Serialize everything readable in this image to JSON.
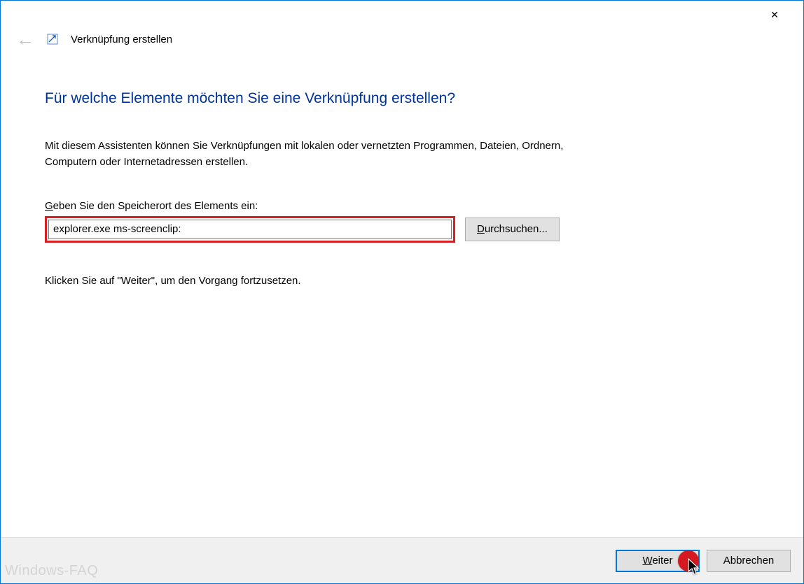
{
  "wizard": {
    "title": "Verknüpfung erstellen",
    "heading": "Für welche Elemente möchten Sie eine Verknüpfung erstellen?",
    "description": "Mit diesem Assistenten können Sie Verknüpfungen mit lokalen oder vernetzten Programmen, Dateien, Ordnern, Computern oder Internetadressen erstellen.",
    "field_label_html": "<u>G</u>eben Sie den Speicherort des Elements ein:",
    "location_value": "explorer.exe ms-screenclip:",
    "browse_label_html": "<u>D</u>urchsuchen...",
    "continue_hint": "Klicken Sie auf \"Weiter\", um den Vorgang fortzusetzen."
  },
  "buttons": {
    "next_html": "<u>W</u>eiter",
    "cancel": "Abbrechen"
  },
  "watermark": "Windows-FAQ"
}
